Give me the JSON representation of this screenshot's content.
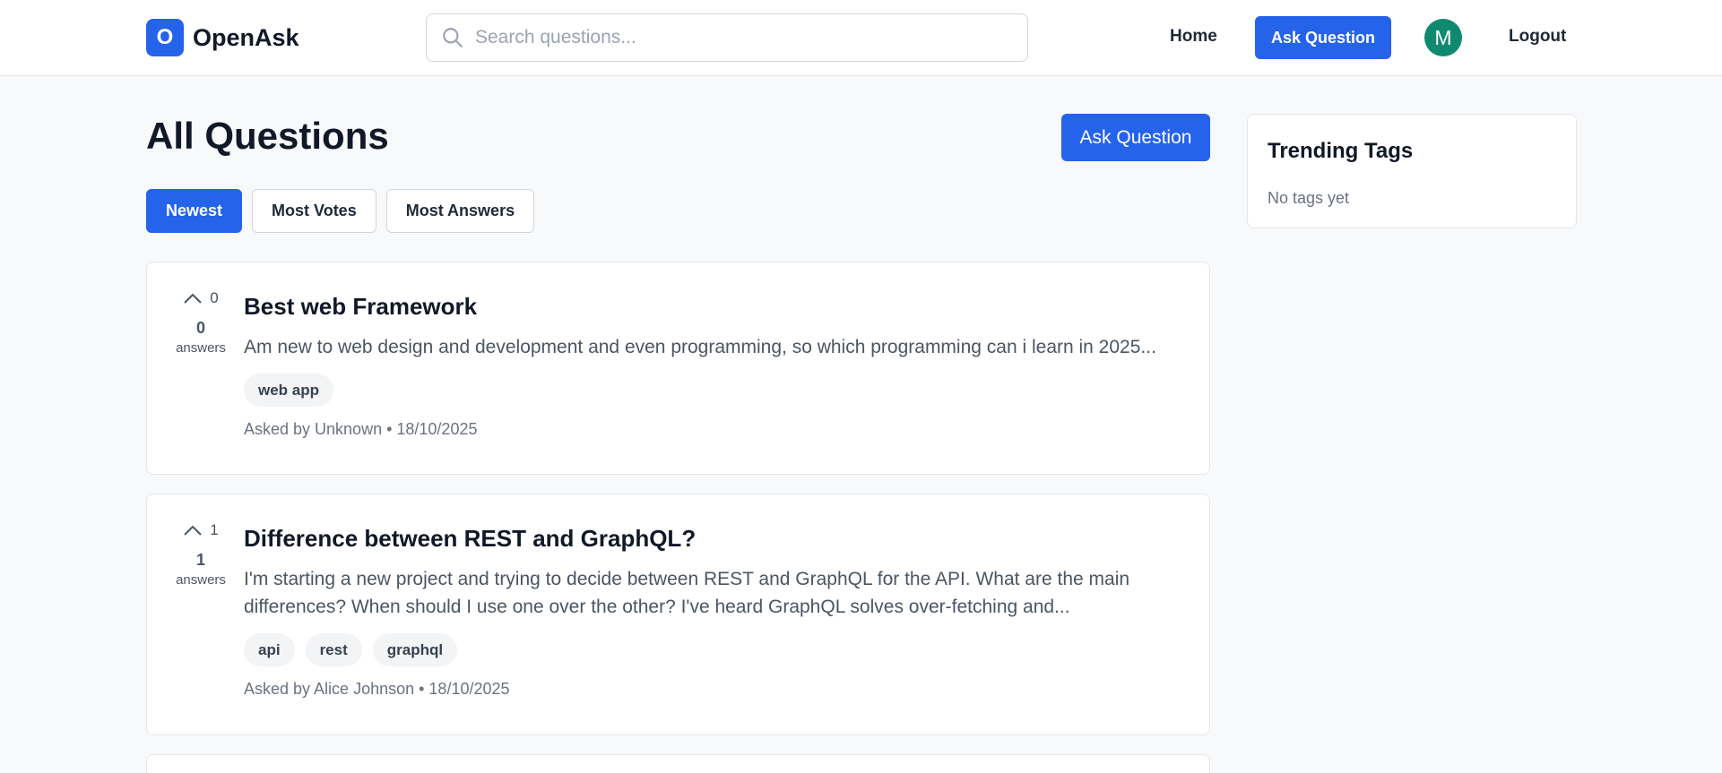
{
  "header": {
    "logo_letter": "O",
    "app_name": "OpenAsk",
    "search_placeholder": "Search questions...",
    "nav_home": "Home",
    "nav_ask": "Ask Question",
    "avatar_initial": "M",
    "nav_logout": "Logout"
  },
  "main": {
    "title": "All Questions",
    "ask_button": "Ask Question",
    "filters": [
      "Newest",
      "Most Votes",
      "Most Answers"
    ],
    "active_filter": "Newest",
    "questions": [
      {
        "votes": "0",
        "answers": "0",
        "answers_label": "answers",
        "title": "Best web Framework",
        "excerpt": "Am new to web design and development and even programming, so which programming can i learn in 2025...",
        "tags": [
          "web app"
        ],
        "meta": "Asked by Unknown • 18/10/2025"
      },
      {
        "votes": "1",
        "answers": "1",
        "answers_label": "answers",
        "title": "Difference between REST and GraphQL?",
        "excerpt": "I'm starting a new project and trying to decide between REST and GraphQL for the API. What are the main differences? When should I use one over the other? I've heard GraphQL solves over-fetching and...",
        "tags": [
          "api",
          "rest",
          "graphql"
        ],
        "meta": "Asked by Alice Johnson • 18/10/2025"
      }
    ]
  },
  "sidebar": {
    "title": "Trending Tags",
    "empty_text": "No tags yet"
  },
  "colors": {
    "primary": "#2563eb",
    "avatar": "#0f8a6e",
    "background": "#f8f9fb"
  }
}
